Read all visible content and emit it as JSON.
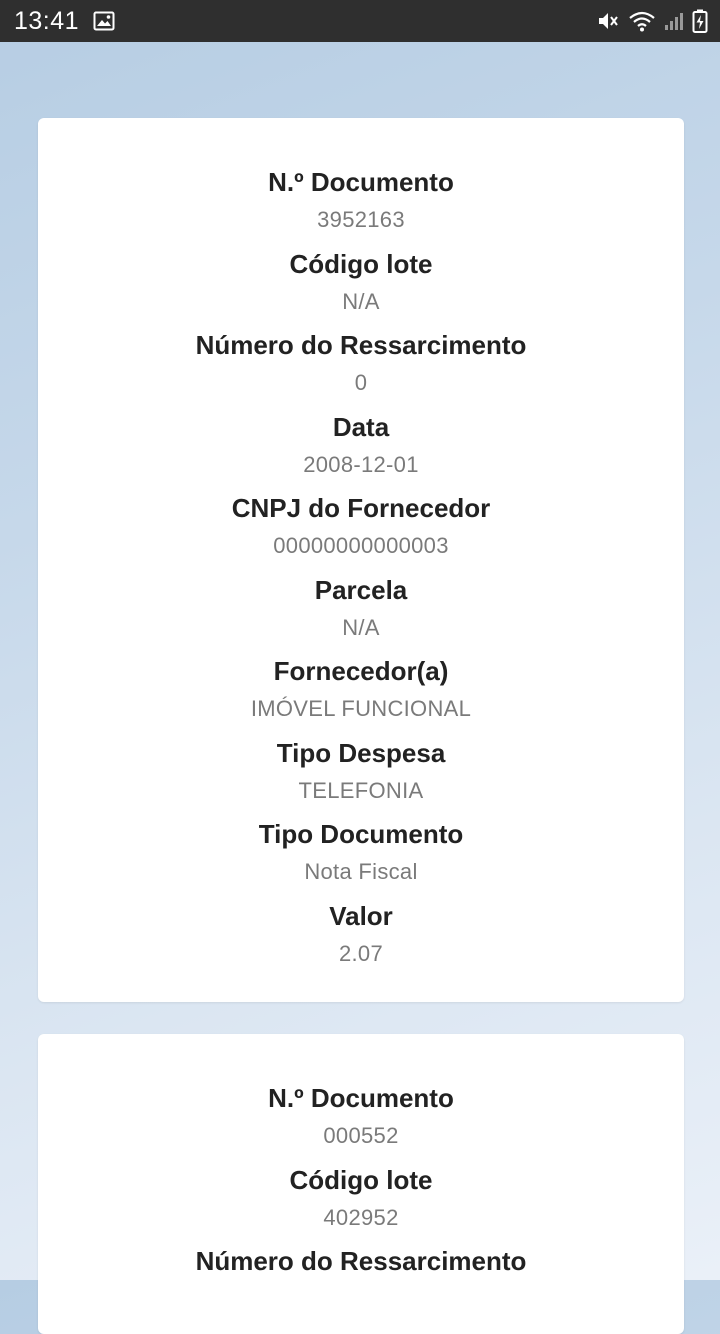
{
  "status_bar": {
    "time": "13:41",
    "left_icons": [
      "image-icon"
    ],
    "right_icons": [
      "mute-icon",
      "wifi-icon",
      "signal-icon",
      "battery-charging-icon"
    ]
  },
  "records": [
    {
      "fields": [
        {
          "label": "N.º Documento",
          "value": "3952163"
        },
        {
          "label": "Código lote",
          "value": "N/A"
        },
        {
          "label": "Número do Ressarcimento",
          "value": "0"
        },
        {
          "label": "Data",
          "value": "2008-12-01"
        },
        {
          "label": "CNPJ do Fornecedor",
          "value": "00000000000003"
        },
        {
          "label": "Parcela",
          "value": "N/A"
        },
        {
          "label": "Fornecedor(a)",
          "value": "IMÓVEL FUNCIONAL"
        },
        {
          "label": "Tipo Despesa",
          "value": "TELEFONIA"
        },
        {
          "label": "Tipo Documento",
          "value": "Nota Fiscal"
        },
        {
          "label": "Valor",
          "value": "2.07"
        }
      ]
    },
    {
      "fields": [
        {
          "label": "N.º Documento",
          "value": "000552"
        },
        {
          "label": "Código lote",
          "value": "402952"
        },
        {
          "label": "Número do Ressarcimento",
          "value": ""
        }
      ]
    }
  ]
}
